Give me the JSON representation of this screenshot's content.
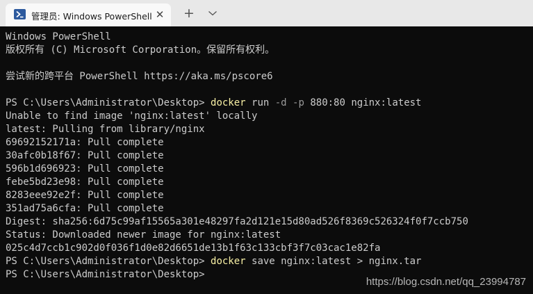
{
  "tab": {
    "title": "管理员: Windows PowerShell",
    "close": "✕",
    "icon": "powershell-icon"
  },
  "tabbar": {
    "new_tab": "+",
    "dropdown_icon": "chevron-down-icon"
  },
  "terminal": {
    "banner1": "Windows PowerShell",
    "banner2": "版权所有 (C) Microsoft Corporation。保留所有权利。",
    "banner3": "尝试新的跨平台 PowerShell https://aka.ms/pscore6",
    "prompt": "PS C:\\Users\\Administrator\\Desktop> ",
    "cmd1": {
      "exe": "docker",
      "part1": " run ",
      "flag1": "-d",
      "space": " ",
      "flag2": "-p",
      "rest": " 880:80 nginx:latest"
    },
    "output": [
      "Unable to find image 'nginx:latest' locally",
      "latest: Pulling from library/nginx",
      "69692152171a: Pull complete",
      "30afc0b18f67: Pull complete",
      "596b1d696923: Pull complete",
      "febe5bd23e98: Pull complete",
      "8283eee92e2f: Pull complete",
      "351ad75a6cfa: Pull complete",
      "Digest: sha256:6d75c99af15565a301e48297fa2d121e15d80ad526f8369c526324f0f7ccb750",
      "Status: Downloaded newer image for nginx:latest",
      "025c4d7ccb1c902d0f036f1d0e82d6651de13b1f63c133cbf3f7c03cac1e82fa"
    ],
    "cmd2": {
      "exe": "docker",
      "rest": " save nginx:latest > nginx.tar"
    }
  },
  "watermark": "https://blog.csdn.net/qq_23994787",
  "colors": {
    "background": "#0c0c0c",
    "text": "#cccccc",
    "command": "#f9f1a5",
    "flag": "#9a9a9a",
    "tabbar": "#e8e8e8"
  }
}
